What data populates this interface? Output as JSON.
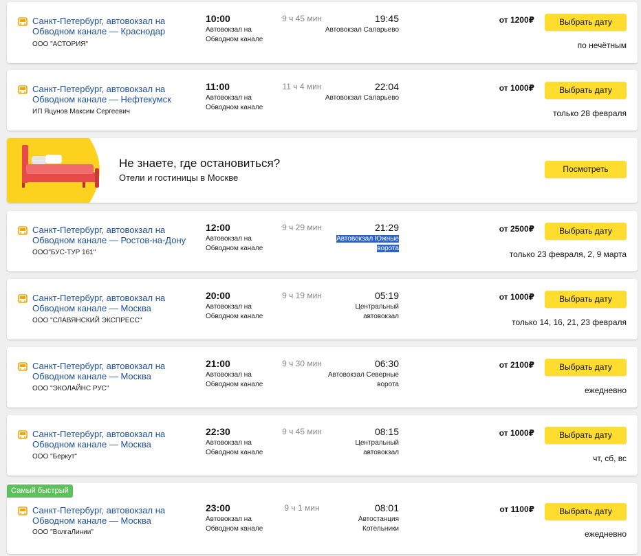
{
  "colors": {
    "link": "#1e4f9c",
    "button": "#fedd2e",
    "badge": "#5dc05d",
    "highlight": "#2c63c8"
  },
  "icons": {
    "route": "bus-icon",
    "promo": "bed-illustration"
  },
  "promo": {
    "title": "Не знаете, где остановиться?",
    "subtitle": "Отели и гостиницы в Москве",
    "button": "Посмотреть"
  },
  "badge": "Самый быстрый",
  "trips": [
    {
      "route": "Санкт-Петербург, автовокзал на Обводном канале — Краснодар",
      "carrier": "ООО \"АСТОРИЯ\"",
      "dep_time": "10:00",
      "dep_station": "Автовокзал на Обводном канале",
      "duration": "9 ч 45 мин",
      "arr_time": "19:45",
      "arr_station": "Автовокзал Саларьево",
      "price": "от 1200₽",
      "button": "Выбрать дату",
      "schedule": "по нечётным"
    },
    {
      "route": "Санкт-Петербург, автовокзал на Обводном канале — Нефтекумск",
      "carrier": "ИП Яцунов Максим Сергеевич",
      "dep_time": "11:00",
      "dep_station": "Автовокзал на Обводном канале",
      "duration": "11 ч 4 мин",
      "arr_time": "22:04",
      "arr_station": "Автовокзал Саларьево",
      "price": "от 1000₽",
      "button": "Выбрать дату",
      "schedule": "только 28 февраля"
    },
    {
      "route": "Санкт-Петербург, автовокзал на Обводном канале — Ростов-на-Дону",
      "carrier": "ООО\"БУС-ТУР 161\"",
      "dep_time": "12:00",
      "dep_station": "Автовокзал на Обводном канале",
      "duration": "9 ч 29 мин",
      "arr_time": "21:29",
      "arr_station": "Автовокзал Южные ворота",
      "price": "от 2500₽",
      "button": "Выбрать дату",
      "schedule": "только 23 февраля, 2, 9 марта"
    },
    {
      "route": "Санкт-Петербург, автовокзал на Обводном канале — Москва",
      "carrier": "ООО \"СЛАВЯНСКИЙ ЭКСПРЕСС\"",
      "dep_time": "20:00",
      "dep_station": "Автовокзал на Обводном канале",
      "duration": "9 ч 19 мин",
      "arr_time": "05:19",
      "arr_station": "Центральный автовокзал",
      "price": "от 1000₽",
      "button": "Выбрать дату",
      "schedule": "только 14, 16, 21, 23 февраля"
    },
    {
      "route": "Санкт-Петербург, автовокзал на Обводном канале — Москва",
      "carrier": "ООО \"ЭКОЛАЙНС РУС\"",
      "dep_time": "21:00",
      "dep_station": "Автовокзал на Обводном канале",
      "duration": "9 ч 30 мин",
      "arr_time": "06:30",
      "arr_station": "Автовокзал Северные ворота",
      "price": "от 2100₽",
      "button": "Выбрать дату",
      "schedule": "ежедневно"
    },
    {
      "route": "Санкт-Петербург, автовокзал на Обводном канале — Москва",
      "carrier": "ООО \"Беркут\"",
      "dep_time": "22:30",
      "dep_station": "Автовокзал на Обводном канале",
      "duration": "9 ч 45 мин",
      "arr_time": "08:15",
      "arr_station": "Центральный автовокзал",
      "price": "от 1000₽",
      "button": "Выбрать дату",
      "schedule": "чт, сб, вс"
    },
    {
      "route": "Санкт-Петербург, автовокзал на Обводном канале — Москва",
      "carrier": "ООО \"ВолгаЛинии\"",
      "dep_time": "23:00",
      "dep_station": "Автовокзал на Обводном канале",
      "duration": "9 ч 1 мин",
      "arr_time": "08:01",
      "arr_station": "Автостанция Котельники",
      "price": "от 1100₽",
      "button": "Выбрать дату",
      "schedule": "ежедневно"
    }
  ]
}
